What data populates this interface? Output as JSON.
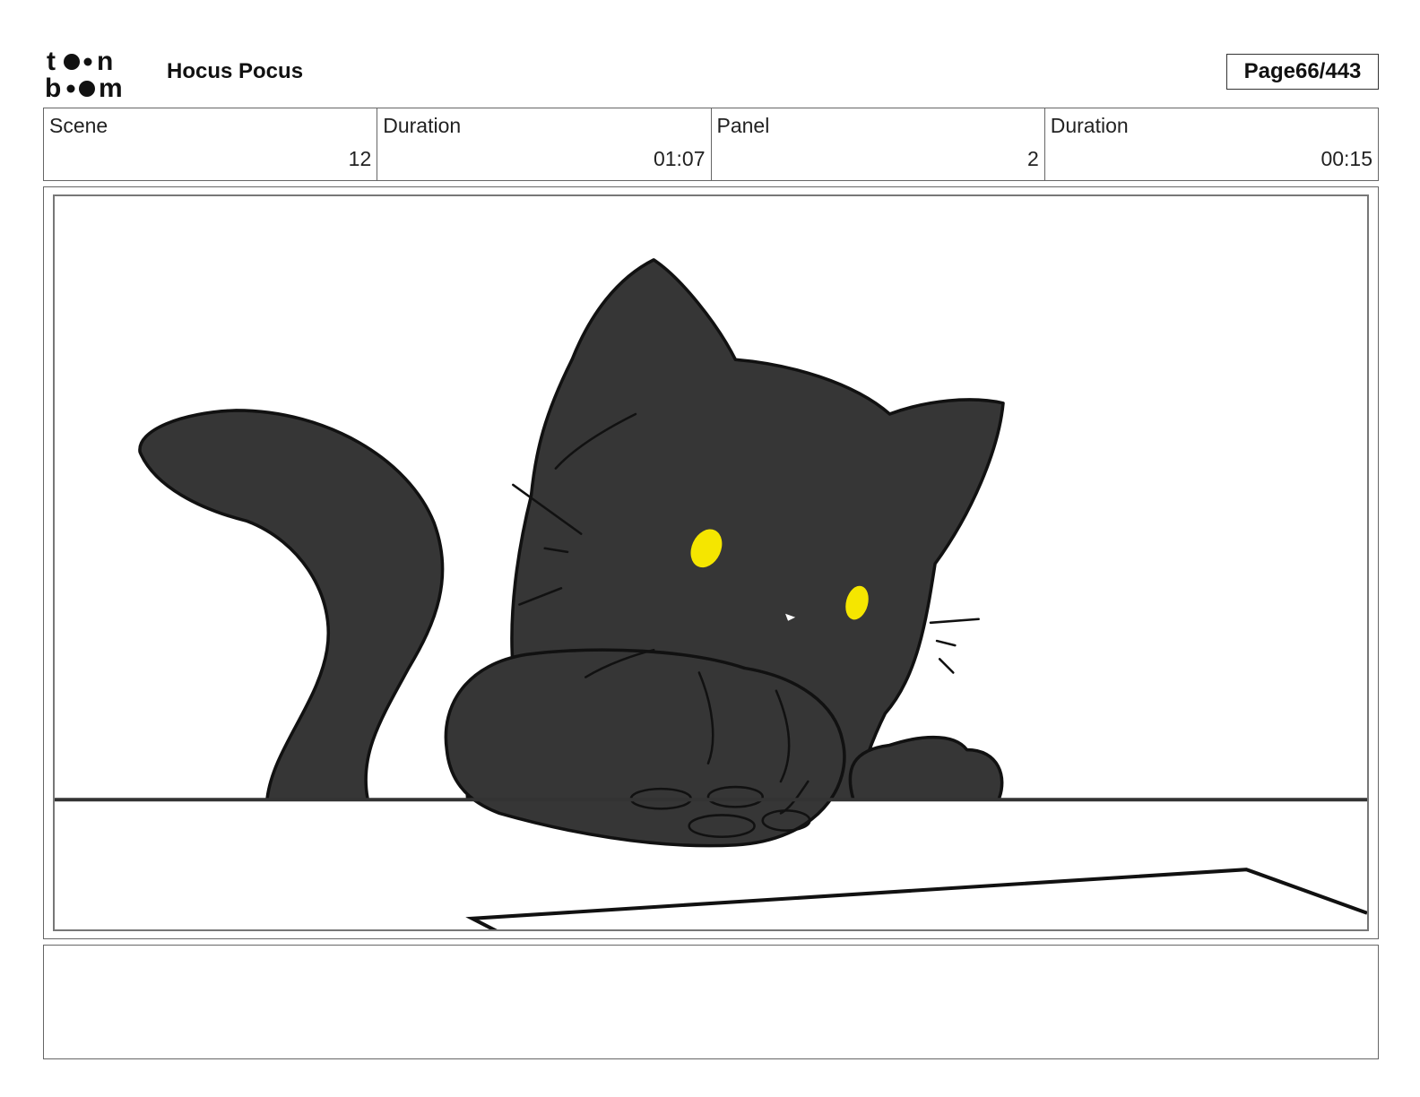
{
  "header": {
    "logo_text": "toon boom",
    "project_title": "Hocus Pocus",
    "page_label": "Page",
    "page_number": "66/443"
  },
  "info": [
    {
      "label": "Scene",
      "value": "12"
    },
    {
      "label": "Duration",
      "value": "01:07"
    },
    {
      "label": "Panel",
      "value": "2"
    },
    {
      "label": "Duration",
      "value": "00:15"
    }
  ],
  "panel": {
    "description": "black cat with yellow eyes resting paw on a table edge",
    "colors": {
      "cat_fill": "#363636",
      "eye": "#f5e600",
      "line": "#111111"
    }
  },
  "notes": {
    "text": ""
  }
}
